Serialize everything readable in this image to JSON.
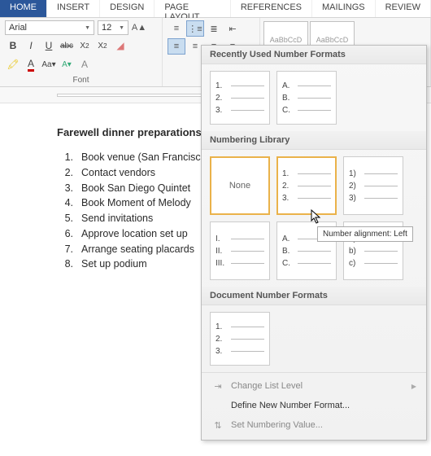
{
  "tabs": [
    "HOME",
    "INSERT",
    "DESIGN",
    "PAGE LAYOUT",
    "REFERENCES",
    "MAILINGS",
    "REVIEW"
  ],
  "active_tab": 0,
  "font": {
    "name": "Arial",
    "size": "12",
    "group_label": "Font"
  },
  "doc": {
    "title": "Farewell dinner preparations",
    "items": [
      "Book venue (San Francisco)",
      "Contact vendors",
      "Book San Diego Quintet",
      "Book Moment of Melody",
      "Send invitations",
      "Approve location set up",
      "Arrange seating placards",
      "Set up podium"
    ]
  },
  "dropdown": {
    "recent_title": "Recently Used Number Formats",
    "library_title": "Numbering Library",
    "docfmt_title": "Document Number Formats",
    "none_label": "None",
    "recent": [
      [
        "1.",
        "2.",
        "3."
      ],
      [
        "A.",
        "B.",
        "C."
      ]
    ],
    "library": [
      null,
      [
        "1.",
        "2.",
        "3."
      ],
      [
        "1)",
        "2)",
        "3)"
      ],
      [
        "I.",
        "II.",
        "III."
      ],
      [
        "A.",
        "B.",
        "C."
      ],
      [
        "a)",
        "b)",
        "c)"
      ]
    ],
    "docfmt": [
      [
        "1.",
        "2.",
        "3."
      ]
    ],
    "footer": {
      "change_level": "Change List Level",
      "define_new": "Define New Number Format...",
      "set_value": "Set Numbering Value..."
    }
  },
  "tooltip": "Number alignment: Left"
}
